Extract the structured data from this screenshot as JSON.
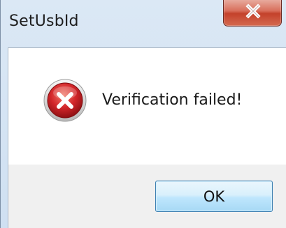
{
  "window": {
    "title": "SetUsbId"
  },
  "dialog": {
    "message": "Verification failed!",
    "icon": "error-icon",
    "ok_label": "OK"
  },
  "colors": {
    "close_button": "#c4412b",
    "ok_border": "#3c7fb1",
    "error_red": "#d3262a"
  }
}
